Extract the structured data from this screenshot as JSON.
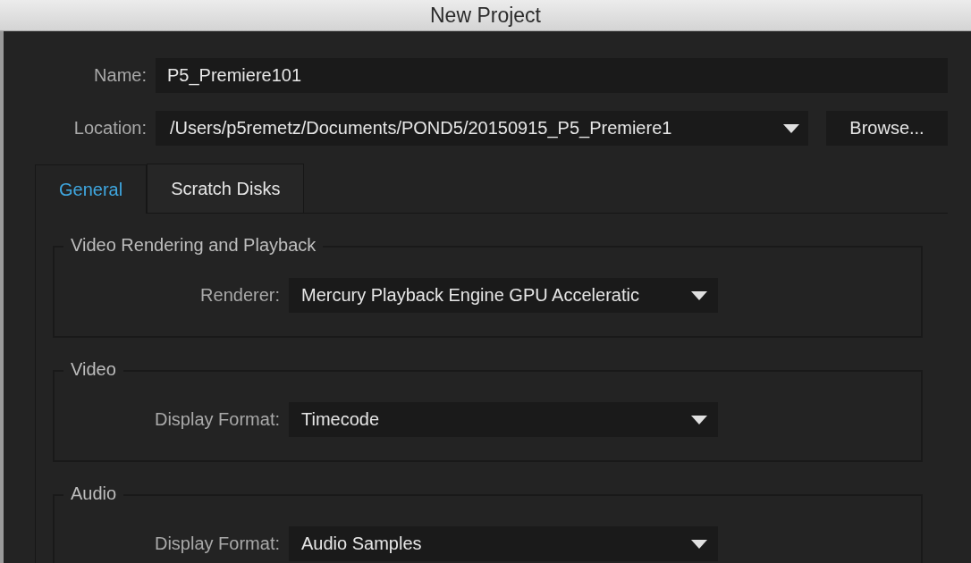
{
  "window": {
    "title": "New Project"
  },
  "name": {
    "label": "Name:",
    "value": "P5_Premiere101"
  },
  "location": {
    "label": "Location:",
    "value": "/Users/p5remetz/Documents/POND5/20150915_P5_Premiere1"
  },
  "browse_button": {
    "label": "Browse..."
  },
  "tabs": [
    {
      "label": "General",
      "selected": true
    },
    {
      "label": "Scratch Disks",
      "selected": false
    }
  ],
  "sections": [
    {
      "title": "Video Rendering and Playback",
      "fields": [
        {
          "label": "Renderer:",
          "value": "Mercury Playback Engine GPU Acceleratic"
        }
      ]
    },
    {
      "title": "Video",
      "fields": [
        {
          "label": "Display Format:",
          "value": "Timecode"
        }
      ]
    },
    {
      "title": "Audio",
      "fields": [
        {
          "label": "Display Format:",
          "value": "Audio Samples"
        }
      ]
    }
  ]
}
